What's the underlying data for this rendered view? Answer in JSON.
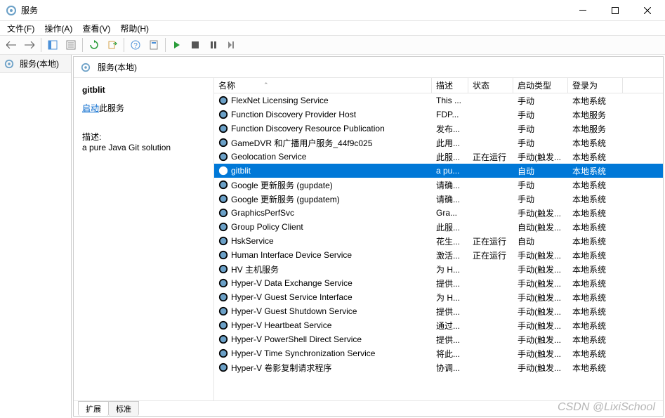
{
  "window": {
    "title": "服务"
  },
  "menu": {
    "file": "文件(F)",
    "action": "操作(A)",
    "view": "查看(V)",
    "help": "帮助(H)"
  },
  "sidebar": {
    "root": "服务(本地)"
  },
  "content": {
    "header": "服务(本地)"
  },
  "detail": {
    "title": "gitblit",
    "startLink": "启动",
    "startSuffix": "此服务",
    "descLabel": "描述:",
    "descText": "a pure Java Git solution"
  },
  "columns": {
    "name": "名称",
    "desc": "描述",
    "status": "状态",
    "startType": "启动类型",
    "logon": "登录为"
  },
  "services": [
    {
      "name": "FlexNet Licensing Service",
      "desc": "This ...",
      "status": "",
      "start": "手动",
      "logon": "本地系统"
    },
    {
      "name": "Function Discovery Provider Host",
      "desc": "FDP...",
      "status": "",
      "start": "手动",
      "logon": "本地服务"
    },
    {
      "name": "Function Discovery Resource Publication",
      "desc": "发布...",
      "status": "",
      "start": "手动",
      "logon": "本地服务"
    },
    {
      "name": "GameDVR 和广播用户服务_44f9c025",
      "desc": "此用...",
      "status": "",
      "start": "手动",
      "logon": "本地系统"
    },
    {
      "name": "Geolocation Service",
      "desc": "此服...",
      "status": "正在运行",
      "start": "手动(触发...",
      "logon": "本地系统"
    },
    {
      "name": "gitblit",
      "desc": "a pu...",
      "status": "",
      "start": "自动",
      "logon": "本地系统",
      "selected": true
    },
    {
      "name": "Google 更新服务 (gupdate)",
      "desc": "请确...",
      "status": "",
      "start": "手动",
      "logon": "本地系统"
    },
    {
      "name": "Google 更新服务 (gupdatem)",
      "desc": "请确...",
      "status": "",
      "start": "手动",
      "logon": "本地系统"
    },
    {
      "name": "GraphicsPerfSvc",
      "desc": "Gra...",
      "status": "",
      "start": "手动(触发...",
      "logon": "本地系统"
    },
    {
      "name": "Group Policy Client",
      "desc": "此服...",
      "status": "",
      "start": "自动(触发...",
      "logon": "本地系统"
    },
    {
      "name": "HskService",
      "desc": "花生...",
      "status": "正在运行",
      "start": "自动",
      "logon": "本地系统"
    },
    {
      "name": "Human Interface Device Service",
      "desc": "激活...",
      "status": "正在运行",
      "start": "手动(触发...",
      "logon": "本地系统"
    },
    {
      "name": "HV 主机服务",
      "desc": "为 H...",
      "status": "",
      "start": "手动(触发...",
      "logon": "本地系统"
    },
    {
      "name": "Hyper-V Data Exchange Service",
      "desc": "提供...",
      "status": "",
      "start": "手动(触发...",
      "logon": "本地系统"
    },
    {
      "name": "Hyper-V Guest Service Interface",
      "desc": "为 H...",
      "status": "",
      "start": "手动(触发...",
      "logon": "本地系统"
    },
    {
      "name": "Hyper-V Guest Shutdown Service",
      "desc": "提供...",
      "status": "",
      "start": "手动(触发...",
      "logon": "本地系统"
    },
    {
      "name": "Hyper-V Heartbeat Service",
      "desc": "通过...",
      "status": "",
      "start": "手动(触发...",
      "logon": "本地系统"
    },
    {
      "name": "Hyper-V PowerShell Direct Service",
      "desc": "提供...",
      "status": "",
      "start": "手动(触发...",
      "logon": "本地系统"
    },
    {
      "name": "Hyper-V Time Synchronization Service",
      "desc": "将此...",
      "status": "",
      "start": "手动(触发...",
      "logon": "本地系统"
    },
    {
      "name": "Hyper-V 卷影复制请求程序",
      "desc": "协调...",
      "status": "",
      "start": "手动(触发...",
      "logon": "本地系统"
    }
  ],
  "tabs": {
    "extended": "扩展",
    "standard": "标准"
  },
  "watermark": "CSDN @LixiSchool"
}
